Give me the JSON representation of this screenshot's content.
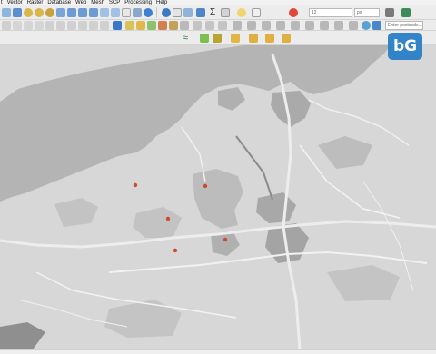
{
  "menu": [
    "t",
    "Vector",
    "Raster",
    "Database",
    "Web",
    "Mesh",
    "SCP",
    "Processing",
    "Help"
  ],
  "toolbar": {
    "scale_value": "12",
    "unit_value": "px",
    "geocoder_placeholder": "Enter postcode..."
  },
  "logo_text": "bG",
  "map": {
    "colors": {
      "sea": "#b4b4b4",
      "land": "#d7d7d7",
      "woodland": "#bdbdbd",
      "road": "#efefef",
      "urban": "#9e9e9e",
      "point": "#d0482d"
    },
    "points": [
      "site-1",
      "site-2",
      "site-3",
      "site-4",
      "site-5"
    ]
  },
  "statusbar": {
    "coordinate": "",
    "scale": "",
    "magnifier": "",
    "rotation": ""
  }
}
